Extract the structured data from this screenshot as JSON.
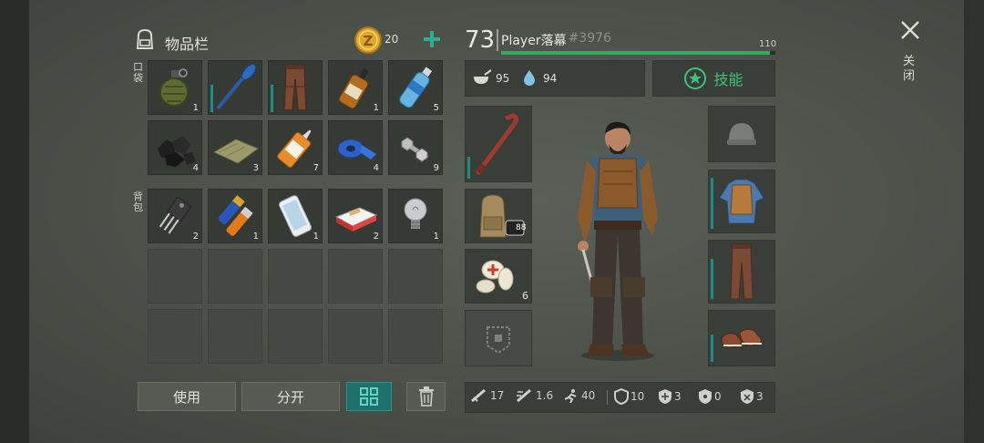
{
  "inventory": {
    "title": "物品栏",
    "coins": "20",
    "pocket_label": "口袋",
    "backpack_label": "背包",
    "pocket_items": [
      {
        "name": "grenade",
        "qty": "1"
      },
      {
        "name": "oar",
        "qty": ""
      },
      {
        "name": "leather-pants",
        "qty": ""
      },
      {
        "name": "whiskey-bottle",
        "qty": "1"
      },
      {
        "name": "water-bottle",
        "qty": "5"
      },
      {
        "name": "coal",
        "qty": "4"
      },
      {
        "name": "cloth",
        "qty": "3"
      },
      {
        "name": "glue",
        "qty": "7"
      },
      {
        "name": "duct-tape",
        "qty": "4"
      },
      {
        "name": "bolts",
        "qty": "9"
      }
    ],
    "backpack_items": [
      {
        "name": "transistor",
        "qty": "2"
      },
      {
        "name": "batteries",
        "qty": "1"
      },
      {
        "name": "phone",
        "qty": "1"
      },
      {
        "name": "cigarettes",
        "qty": "2"
      },
      {
        "name": "light-bulb",
        "qty": "1"
      }
    ],
    "buttons": {
      "use": "使用",
      "split": "分开"
    }
  },
  "player": {
    "level": "73",
    "name": "Player落幕",
    "id": "#3976",
    "xp_max": "110",
    "xp_fraction": 0.98,
    "hunger": "95",
    "thirst": "94",
    "skills_label": "技能"
  },
  "equipment": {
    "weapon_qty": "",
    "medkit_qty": "6",
    "backpack_badge": "88"
  },
  "stats": {
    "damage": "17",
    "speed": "1.6",
    "move": "40",
    "armor": "10",
    "stat5": "3",
    "stat6": "0",
    "stat7": "3"
  },
  "close": {
    "label": "关闭"
  },
  "colors": {
    "accent": "#2fae5f",
    "teal": "#1f8c86",
    "gold": "#e0a82a"
  }
}
